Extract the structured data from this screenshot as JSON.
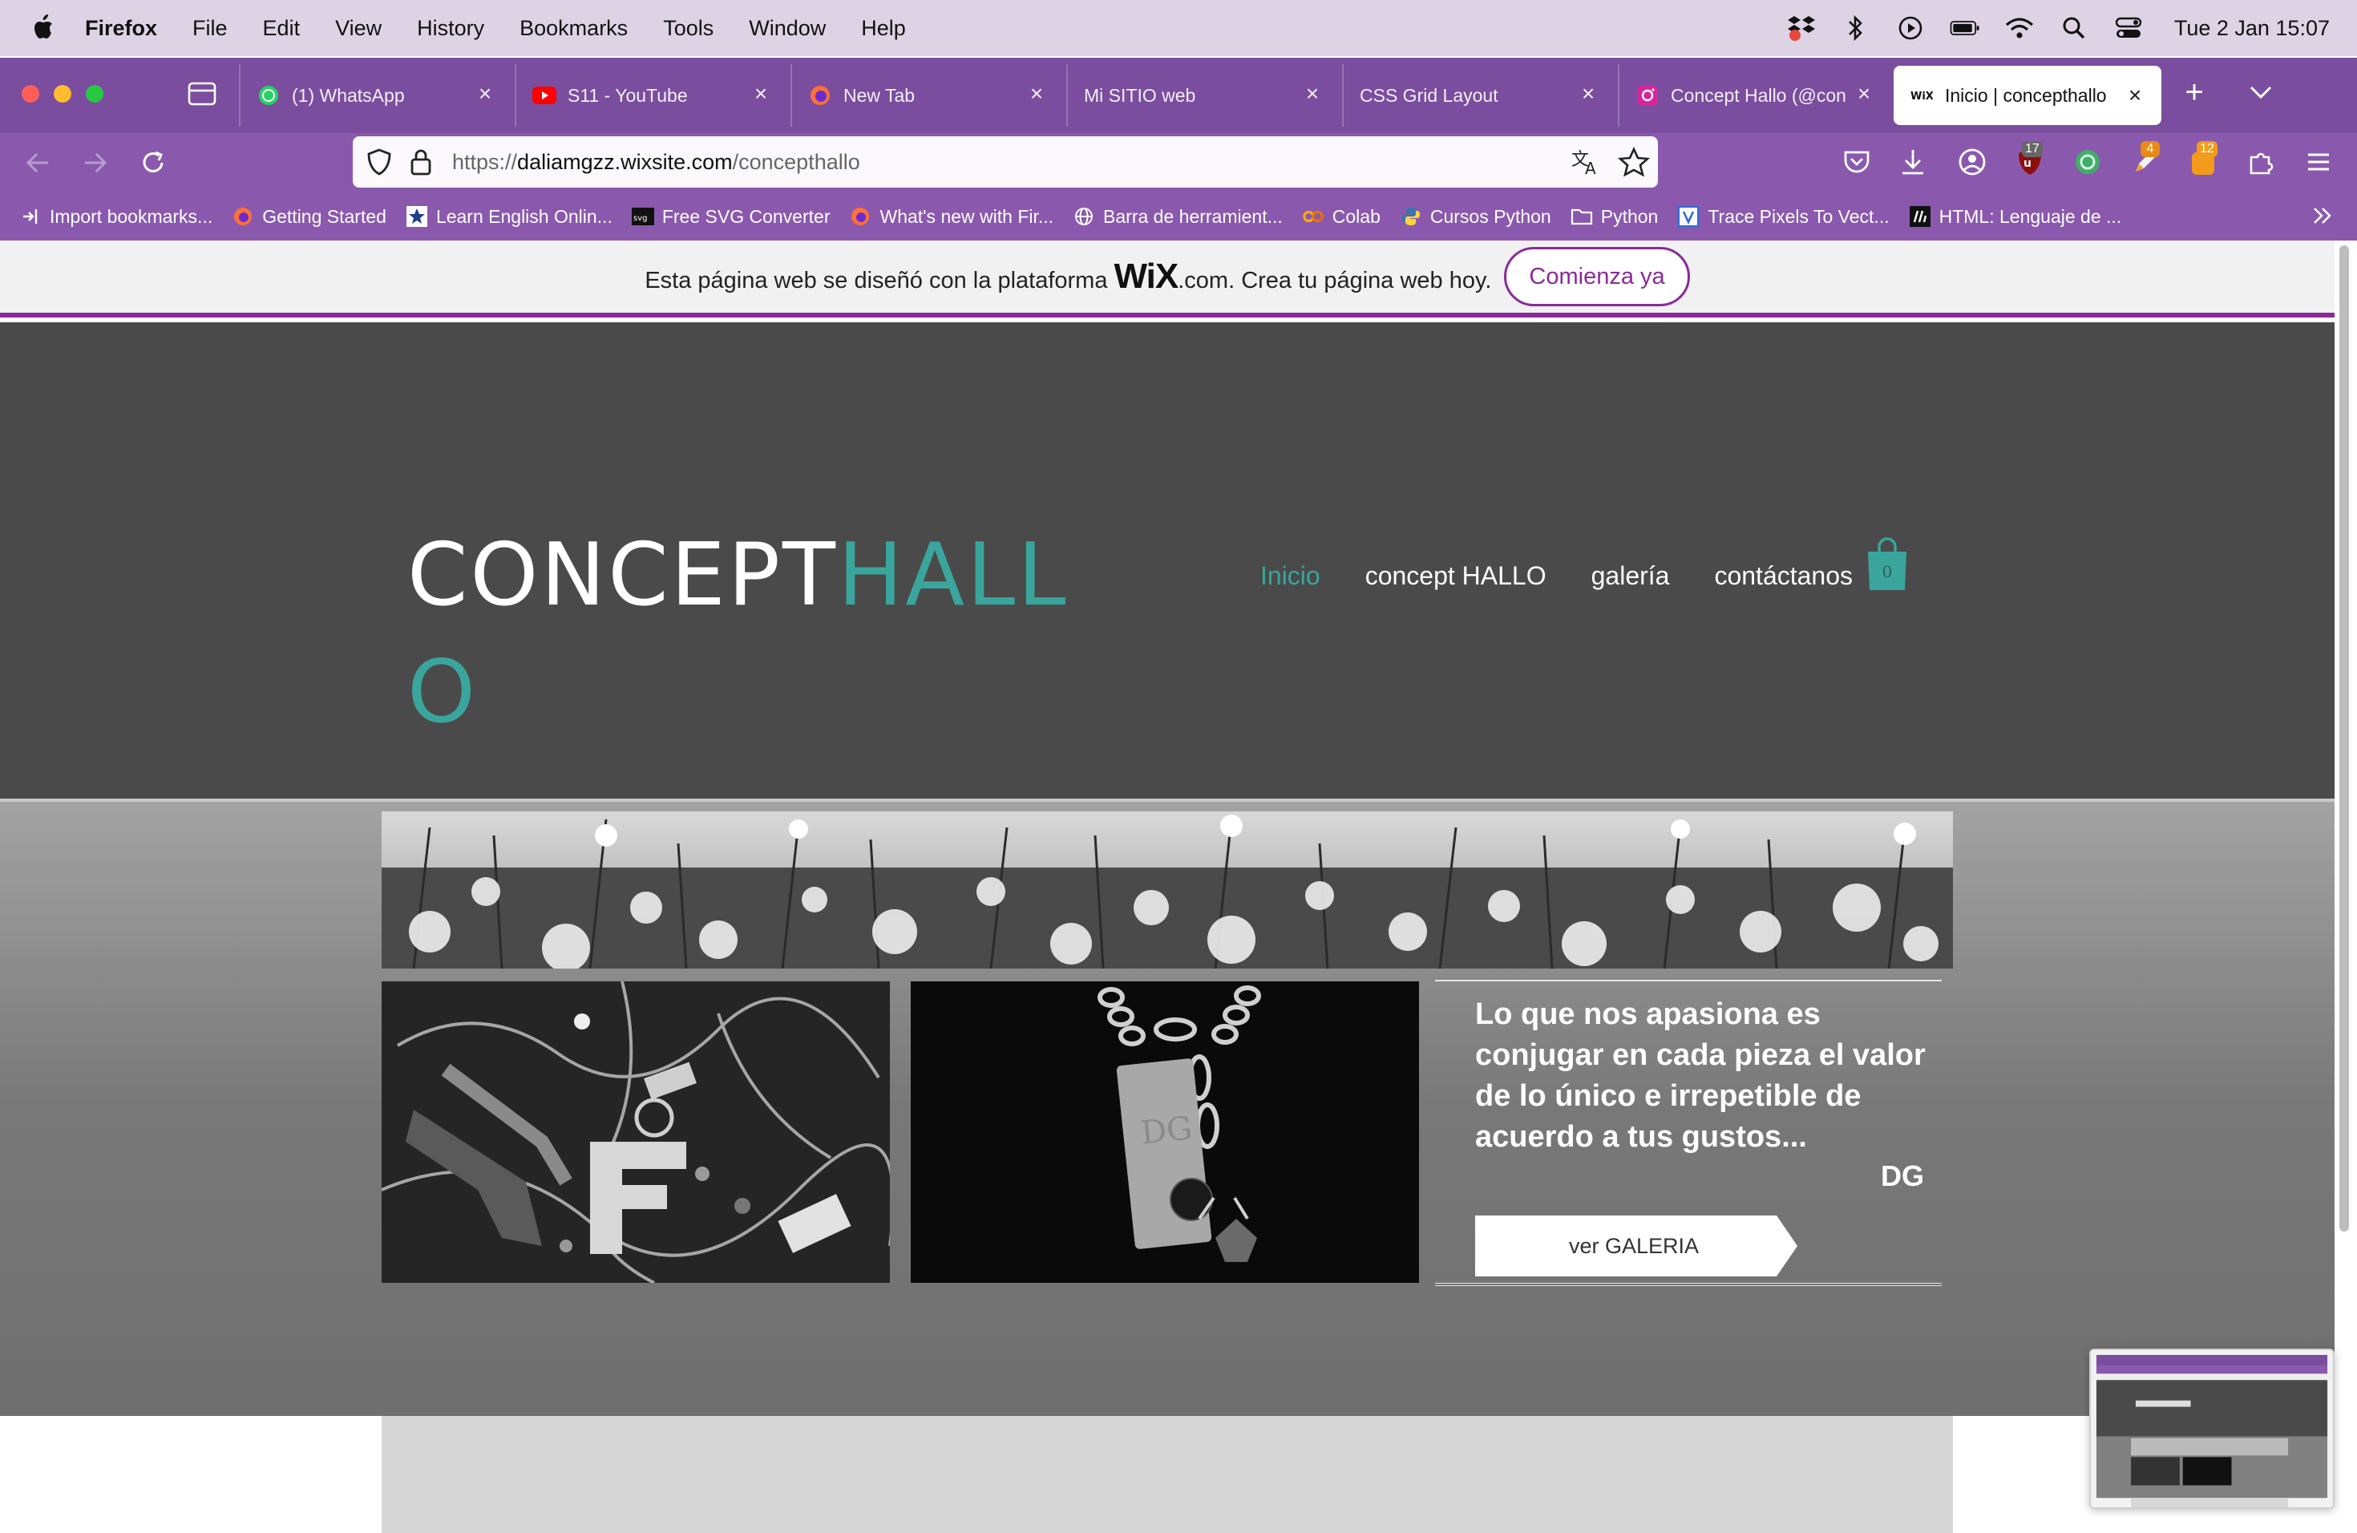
{
  "menubar": {
    "app_name": "Firefox",
    "items": [
      "File",
      "Edit",
      "View",
      "History",
      "Bookmarks",
      "Tools",
      "Window",
      "Help"
    ],
    "clock": "Tue 2 Jan  15:07"
  },
  "tabs": [
    {
      "label": "(1) WhatsApp",
      "icon": "whatsapp-icon"
    },
    {
      "label": "S11 - YouTube",
      "icon": "youtube-icon"
    },
    {
      "label": "New Tab",
      "icon": "firefox-icon"
    },
    {
      "label": "Mi SITIO web",
      "icon": ""
    },
    {
      "label": "CSS Grid Layout",
      "icon": ""
    },
    {
      "label": "Concept Hallo (@con",
      "icon": "instagram-icon"
    },
    {
      "label": "Inicio | concepthallo",
      "icon": "wix-icon",
      "active": true
    }
  ],
  "address_bar": {
    "url_prefix": "https://",
    "url_host": "daliamgzz.wixsite.com",
    "url_path": "/concepthallo"
  },
  "toolbar_badges": {
    "extension_a": "17",
    "extension_b": "4",
    "extension_c": "12"
  },
  "bookmarks": [
    {
      "label": "Import bookmarks...",
      "icon": "import-icon"
    },
    {
      "label": "Getting Started",
      "icon": "firefox-icon"
    },
    {
      "label": "Learn English Onlin...",
      "icon": "star-icon"
    },
    {
      "label": "Free SVG Converter",
      "icon": "svg-icon"
    },
    {
      "label": "What's new with Fir...",
      "icon": "firefox-icon"
    },
    {
      "label": "Barra de herramient...",
      "icon": "globe-icon"
    },
    {
      "label": "Colab",
      "icon": "colab-icon"
    },
    {
      "label": "Cursos Python",
      "icon": "python-icon"
    },
    {
      "label": "Python",
      "icon": "folder-icon"
    },
    {
      "label": "Trace Pixels To Vect...",
      "icon": "vector-icon"
    },
    {
      "label": "HTML: Lenguaje de ...",
      "icon": "mdn-icon"
    }
  ],
  "wix_banner": {
    "text_before": "Esta página web se diseñó con la plataforma ",
    "logo": "WiX",
    "text_after": ".com. Crea tu página web hoy.",
    "button": "Comienza ya"
  },
  "site": {
    "logo_white": "CONCEPT",
    "logo_teal": "HALL",
    "logo_wrap": "O",
    "nav": [
      "Inicio",
      "concept HALLO",
      "galería",
      "contáctanos"
    ],
    "active_nav": "Inicio",
    "cart_count": "0",
    "quote": "Lo que nos apasiona es conjugar en cada pieza el valor de lo único e irrepetible de acuerdo a tus gustos...",
    "signature": "DG",
    "gallery_button": "ver GALERIA"
  },
  "colors": {
    "accent_teal": "#3aa59c",
    "wix_purple": "#8a2a99",
    "firefox_toolbar": "#8a59ad",
    "header_bg": "#4a4a4a"
  }
}
